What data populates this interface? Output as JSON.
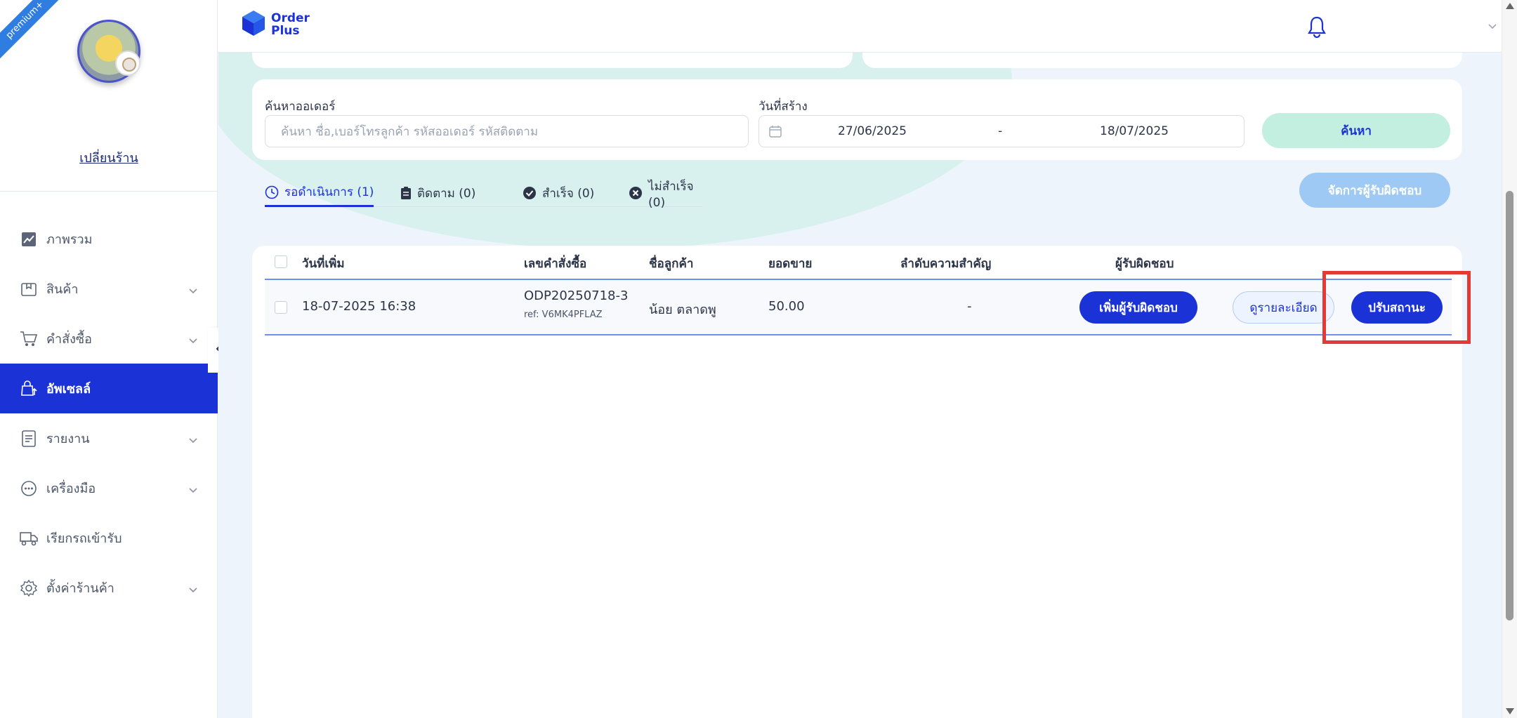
{
  "sidebar": {
    "ribbon": "premium+",
    "change_shop": "เปลี่ยนร้าน",
    "items": [
      {
        "label": "ภาพรวม",
        "icon": "chart-line-icon"
      },
      {
        "label": "สินค้า",
        "icon": "box-icon"
      },
      {
        "label": "คำสั่งซื้อ",
        "icon": "cart-icon"
      },
      {
        "label": "อัพเซลล์",
        "icon": "shopping-bag-up-icon"
      },
      {
        "label": "รายงาน",
        "icon": "report-icon"
      },
      {
        "label": "เครื่องมือ",
        "icon": "chat-dots-icon"
      },
      {
        "label": "เรียกรถเข้ารับ",
        "icon": "truck-icon"
      },
      {
        "label": "ตั้งค่าร้านค้า",
        "icon": "gear-icon"
      }
    ]
  },
  "header": {
    "logo_line1": "Order",
    "logo_line2": "Plus"
  },
  "search": {
    "order_label": "ค้นหาออเดอร์",
    "order_placeholder": "ค้นหา ชื่อ,เบอร์โทรลูกค้า รหัสออเดอร์ รหัสติดตาม",
    "date_label": "วันที่สร้าง",
    "date_from": "27/06/2025",
    "date_sep": "-",
    "date_to": "18/07/2025",
    "button": "ค้นหา"
  },
  "tabs": [
    {
      "label": "รอดำเนินการ (1)"
    },
    {
      "label": "ติดตาม (0)"
    },
    {
      "label": "สำเร็จ (0)"
    },
    {
      "label": "ไม่สำเร็จ (0)"
    }
  ],
  "manage_button": "จัดการผู้รับผิดชอบ",
  "table": {
    "headers": [
      "วันที่เพิ่ม",
      "เลขคำสั่งซื้อ",
      "ชื่อลูกค้า",
      "ยอดขาย",
      "ลำดับความสำคัญ",
      "ผู้รับผิดชอบ"
    ],
    "rows": [
      {
        "date": "18-07-2025 16:38",
        "order_no": "ODP20250718-3",
        "ref": "ref: V6MK4PFLAZ",
        "customer": "น้อย ตลาดพู",
        "amount": "50.00",
        "priority": "-",
        "assign_button": "เพิ่มผู้รับผิดชอบ",
        "detail_button": "ดูรายละเอียด",
        "status_button": "ปรับสถานะ"
      }
    ]
  },
  "colors": {
    "primary": "#1b33d6",
    "highlight": "#e53935",
    "search_button_bg": "#c2efe0",
    "manage_button_bg": "#9ec9f4"
  }
}
